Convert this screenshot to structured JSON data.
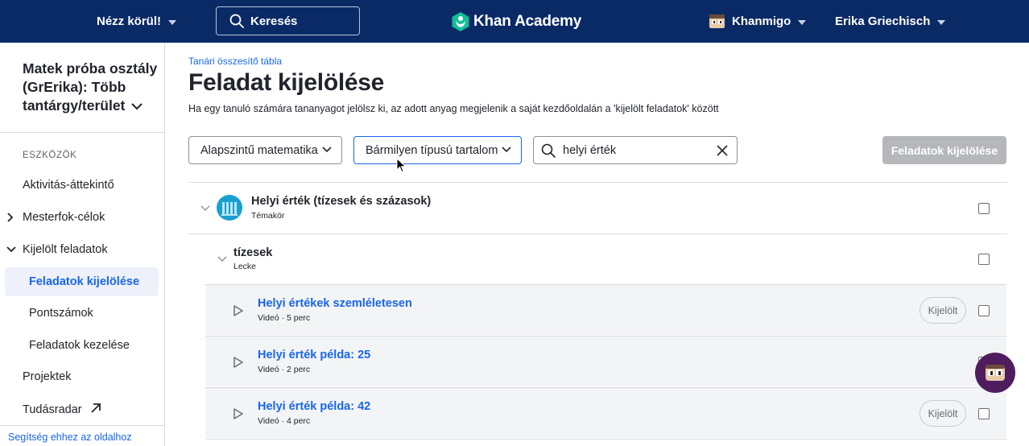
{
  "topnav": {
    "explore_label": "Nézz körül!",
    "search_label": "Keresés",
    "logo_text": "Khan Academy",
    "khanmigo_label": "Khanmigo",
    "user_label": "Erika Griechisch"
  },
  "sidebar": {
    "class_title": "Matek próba osztály (GrErika): Több tantárgy/terület",
    "section_label": "ESZKÖZÖK",
    "items": [
      {
        "label": "Aktivitás-áttekintő"
      },
      {
        "label": "Mesterfok-célok"
      },
      {
        "label": "Kijelölt feladatok"
      },
      {
        "label": "Feladatok kijelölése"
      },
      {
        "label": "Pontszámok"
      },
      {
        "label": "Feladatok kezelése"
      },
      {
        "label": "Projektek"
      },
      {
        "label": "Tudásradar"
      }
    ],
    "help_link": "Segítség ehhez az oldalhoz"
  },
  "main": {
    "breadcrumb": "Tanári összesítő tábla",
    "title": "Feladat kijelölése",
    "description": "Ha egy tanuló számára tananyagot jelölsz ki, az adott anyag megjelenik a saját kezdőoldalán a 'kijelölt feladatok' között",
    "filters": {
      "course_select": "Alapszintű matematika",
      "content_type_select": "Bármilyen típusú tartalom",
      "search_value": "helyi érték",
      "assign_button": "Feladatok kijelölése"
    },
    "unit": {
      "title": "Helyi érték (tízesek és százasok)",
      "type": "Témakör"
    },
    "lesson": {
      "title": "tízesek",
      "type": "Lecke"
    },
    "content_items": [
      {
        "title": "Helyi értékek szemléletesen",
        "meta": "Videó · 5 perc",
        "badge": "Kijelölt"
      },
      {
        "title": "Helyi érték példa: 25",
        "meta": "Videó · 2 perc",
        "badge": ""
      },
      {
        "title": "Helyi érték példa: 42",
        "meta": "Videó · 4 perc",
        "badge": "Kijelölt"
      }
    ]
  },
  "colors": {
    "nav_bg": "#0a2a66",
    "link_blue": "#1865f2",
    "khanmigo_purple": "#4f1c5e",
    "logo_green": "#14bf96"
  }
}
